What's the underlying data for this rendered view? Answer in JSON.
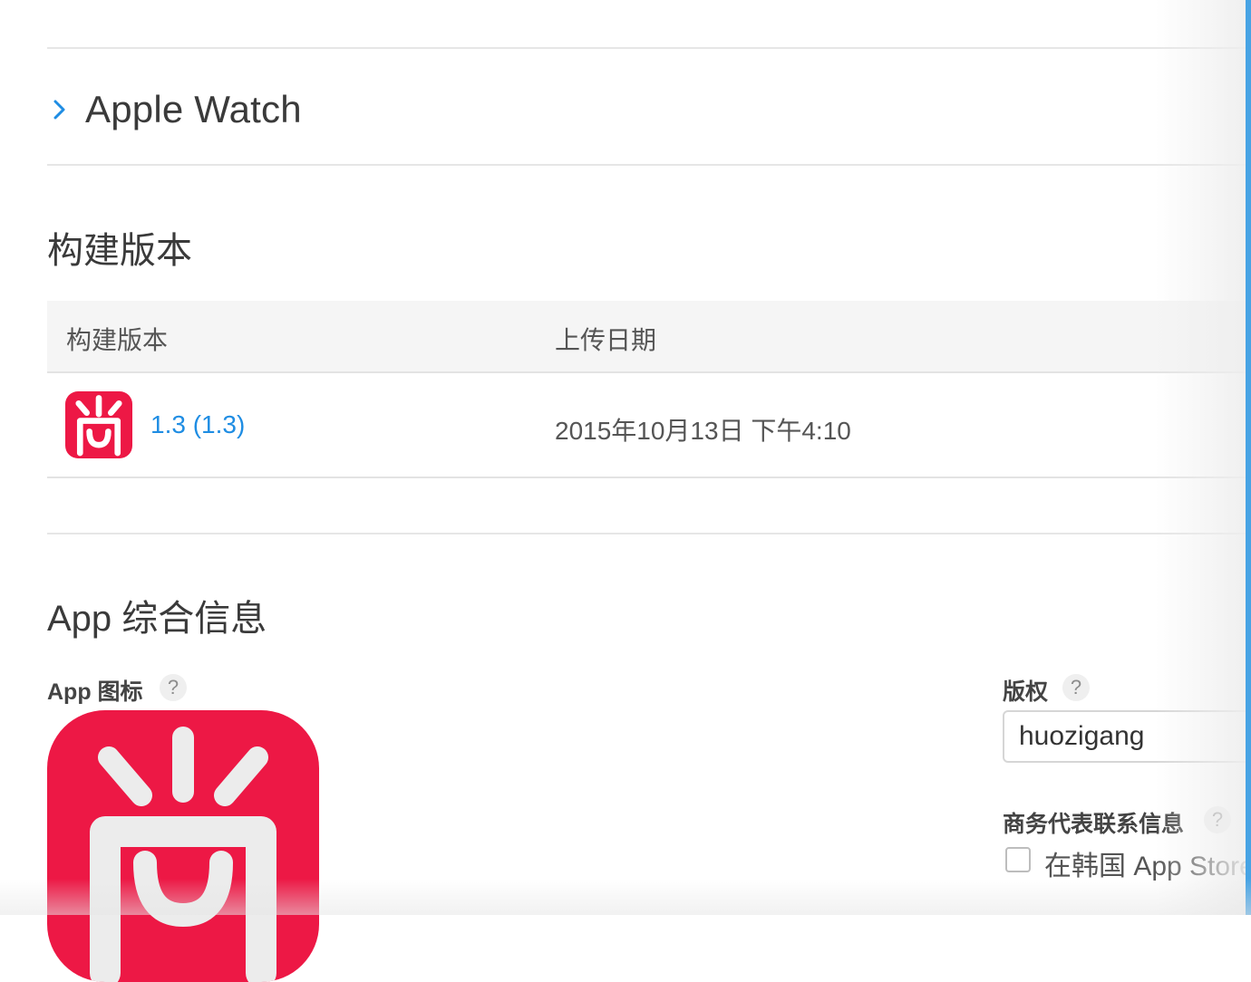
{
  "apple_watch": {
    "label": "Apple Watch",
    "icon": "chevron-right-icon",
    "accent": "#1f8de3"
  },
  "build_section": {
    "title": "构建版本",
    "columns": {
      "build": "构建版本",
      "upload_date": "上传日期"
    },
    "rows": [
      {
        "version": "1.3 (1.3)",
        "upload_date": "2015年10月13日 下午4:10",
        "icon": "app-icon-shang"
      }
    ]
  },
  "info_section": {
    "title": "App 综合信息",
    "app_icon": {
      "label": "App 图标",
      "help": "?",
      "icon": "app-icon-shang",
      "color": "#ed1845"
    },
    "copyright": {
      "label": "版权",
      "help": "?",
      "value": "huozigang"
    },
    "business_contact": {
      "label": "商务代表联系信息",
      "help": "?",
      "checkbox_label": "在韩国 App Store",
      "checked": false
    }
  }
}
